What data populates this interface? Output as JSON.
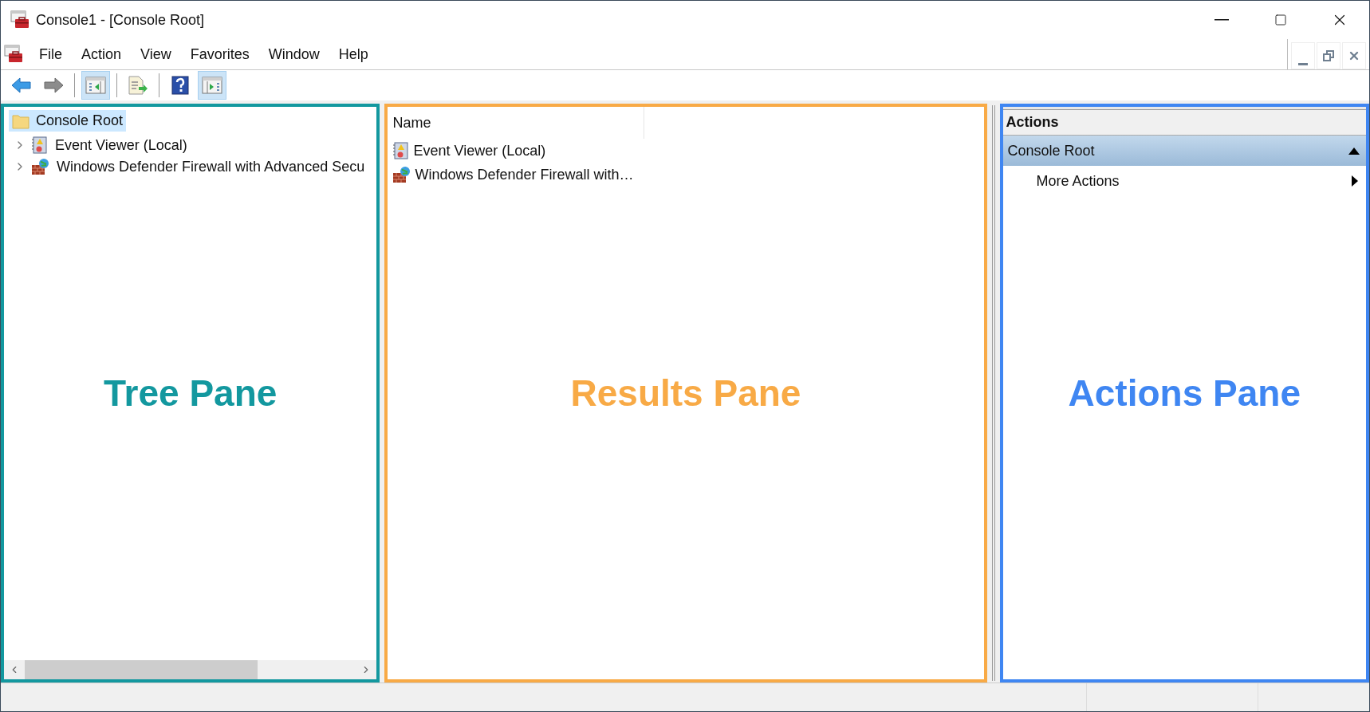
{
  "window": {
    "title": "Console1 - [Console Root]"
  },
  "menu": [
    "File",
    "Action",
    "View",
    "Favorites",
    "Window",
    "Help"
  ],
  "toolbar": [
    {
      "kind": "back",
      "pressed": false
    },
    {
      "kind": "forward",
      "pressed": false
    },
    {
      "kind": "separator"
    },
    {
      "kind": "tree-toggle",
      "pressed": true
    },
    {
      "kind": "separator"
    },
    {
      "kind": "export",
      "pressed": false
    },
    {
      "kind": "separator"
    },
    {
      "kind": "help",
      "pressed": false
    },
    {
      "kind": "actions-toggle",
      "pressed": true
    }
  ],
  "tree": {
    "label": "Console Root",
    "kind": "folder",
    "selected": true,
    "children": [
      {
        "label": "Event Viewer (Local)",
        "kind": "event-viewer",
        "selected": false,
        "expanded": false
      },
      {
        "label": "Windows Defender Firewall with Advanced Secu",
        "kind": "firewall",
        "selected": false,
        "expanded": false
      }
    ]
  },
  "results": {
    "columns": [
      "Name"
    ],
    "rows": [
      {
        "name": "Event Viewer (Local)",
        "kind": "event-viewer"
      },
      {
        "name": "Windows Defender Firewall with…",
        "kind": "firewall"
      }
    ]
  },
  "actions": {
    "header": "Actions",
    "groups": [
      {
        "title": "Console Root",
        "expanded": true,
        "items": [
          {
            "label": "More Actions",
            "submenu": true
          }
        ]
      }
    ]
  },
  "annotations": [
    {
      "label": "Tree Pane",
      "color": "#13989f"
    },
    {
      "label": "Results Pane",
      "color": "#f8aa46"
    },
    {
      "label": "Actions Pane",
      "color": "#3f86f2"
    }
  ]
}
